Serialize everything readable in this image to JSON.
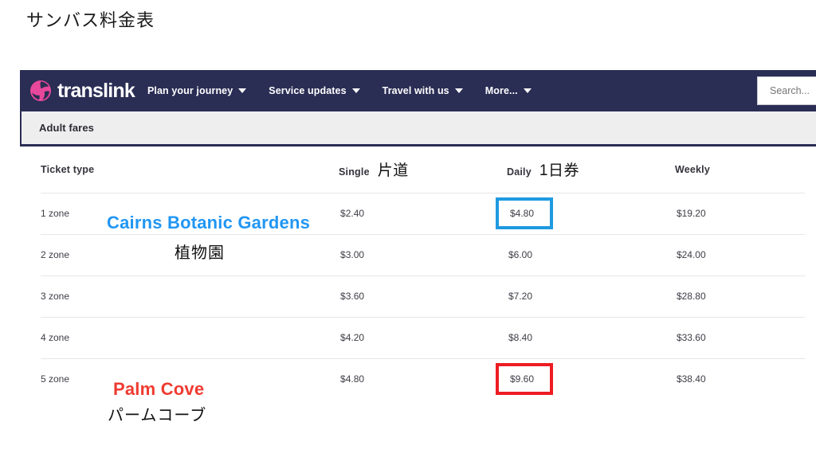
{
  "page": {
    "title_jp": "サンバス料金表"
  },
  "navbar": {
    "brand": "translink",
    "logo_icon": "translink-pinwheel-logo",
    "items": [
      {
        "label": "Plan your journey",
        "has_caret": true
      },
      {
        "label": "Service updates",
        "has_caret": true
      },
      {
        "label": "Travel with us",
        "has_caret": true
      },
      {
        "label": "More...",
        "has_caret": true
      }
    ],
    "search": {
      "value": "",
      "placeholder": "Search..."
    }
  },
  "tabbar": {
    "tabs": [
      {
        "label": "Adult fares",
        "active": true
      }
    ]
  },
  "table": {
    "headers": {
      "ticket_type": "Ticket type",
      "single": "Single",
      "single_jp": "片道",
      "daily": "Daily",
      "daily_jp": "1日券",
      "weekly": "Weekly"
    },
    "rows": [
      {
        "type": "1 zone",
        "single": "$2.40",
        "daily": "$4.80",
        "weekly": "$19.20",
        "daily_highlight": "blue"
      },
      {
        "type": "2 zone",
        "single": "$3.00",
        "daily": "$6.00",
        "weekly": "$24.00",
        "daily_highlight": "none"
      },
      {
        "type": "3 zone",
        "single": "$3.60",
        "daily": "$7.20",
        "weekly": "$28.80",
        "daily_highlight": "none"
      },
      {
        "type": "4 zone",
        "single": "$4.20",
        "daily": "$8.40",
        "weekly": "$33.60",
        "daily_highlight": "none"
      },
      {
        "type": "5 zone",
        "single": "$4.80",
        "daily": "$9.60",
        "weekly": "$38.40",
        "daily_highlight": "red"
      }
    ]
  },
  "annotations": {
    "botanic_en": "Cairns Botanic Gardens",
    "botanic_jp": "植物園",
    "palm_en": "Palm Cove",
    "palm_jp": "パームコーブ"
  },
  "colors": {
    "navbar_bg": "#2a2d54",
    "brand_pink": "#e8489b",
    "tab_bg": "#eeeeef",
    "highlight_blue": "#1e9ae0",
    "highlight_red": "#ee1c23",
    "annotation_blue": "#2196f3",
    "annotation_red": "#ef3b31"
  }
}
